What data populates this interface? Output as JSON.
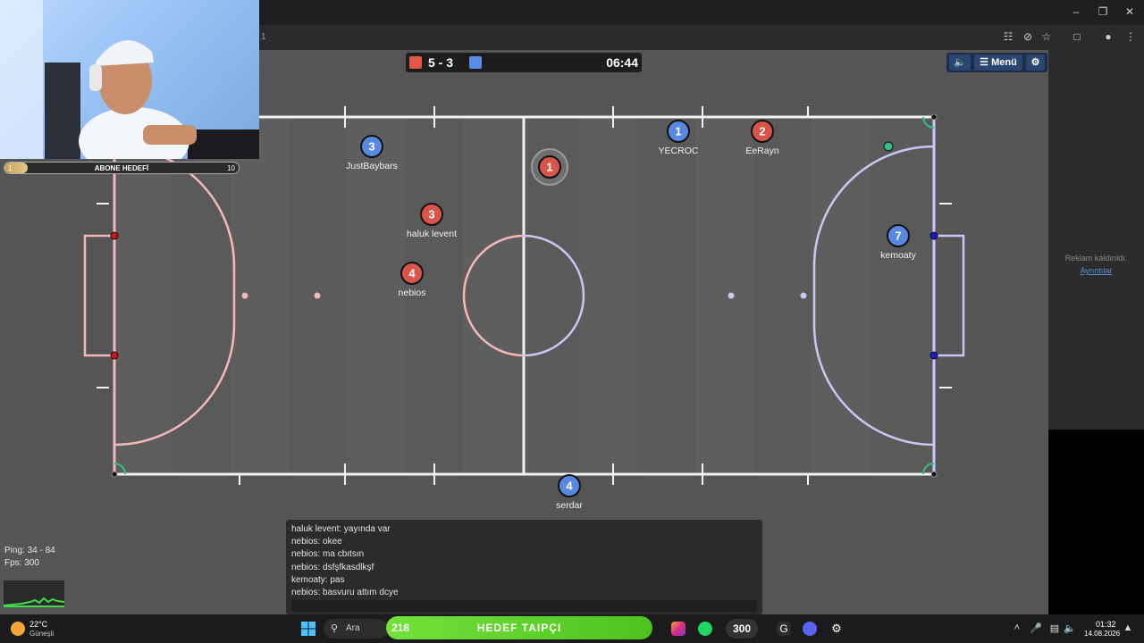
{
  "browser": {
    "url": "1",
    "window_controls": [
      "minimize-icon",
      "restore-icon",
      "close-icon"
    ],
    "toolbar_icons": [
      "translate-icon",
      "eye-off-icon",
      "star-icon",
      "extensions-icon",
      "profile-icon",
      "kebab-icon"
    ]
  },
  "scoreboard": {
    "score": "5 - 3",
    "time": "06:44",
    "red_color": "#e5564a",
    "blue_color": "#5b8de6"
  },
  "menu": {
    "sound_icon": "speaker-icon",
    "menu_label": "Menü",
    "settings_icon": "gear-icon"
  },
  "colors": {
    "red_team": "#d9554a",
    "blue_team": "#5888e0",
    "field": "#555555",
    "left_line": "#f5b8b8",
    "right_line": "#c8c8f5"
  },
  "players": [
    {
      "number": "3",
      "name": "JustBaybars",
      "team": "blue"
    },
    {
      "number": "3",
      "name": "haluk levent",
      "team": "red"
    },
    {
      "number": "4",
      "name": "nebios",
      "team": "red"
    },
    {
      "number": "1",
      "name": "",
      "team": "red"
    },
    {
      "number": "1",
      "name": "YECROC",
      "team": "blue"
    },
    {
      "number": "2",
      "name": "EeRayn",
      "team": "red"
    },
    {
      "number": "7",
      "name": "kemoaty",
      "team": "blue"
    },
    {
      "number": "4",
      "name": "serdar",
      "team": "blue"
    }
  ],
  "ad": {
    "removed": "Reklam kaldırıldı.",
    "details": "Ayrıntılar"
  },
  "overlay": {
    "goal_label": "ABONE HEDEFİ",
    "goal_min": "1",
    "goal_max": "10",
    "goal_progress": 0.1
  },
  "stats": {
    "ping": "Ping: 34 - 84",
    "fps": "Fps: 300"
  },
  "chat": {
    "messages": [
      "haluk levent: yayında var",
      "nebios: okee",
      "nebios: ma cbıtsın",
      "nebios: dsfşfkasdlkşf",
      "kemoaty: pas",
      "nebios: basvuru attım dcye"
    ],
    "input_placeholder": ""
  },
  "taskbar": {
    "temperature": "22°C",
    "condition": "Güneşli",
    "search": "Ara",
    "goal_count": "218",
    "goal_label": "HEDEF TAIPÇI",
    "badge": "300",
    "time": "01:32",
    "date": "14.08.2026"
  }
}
